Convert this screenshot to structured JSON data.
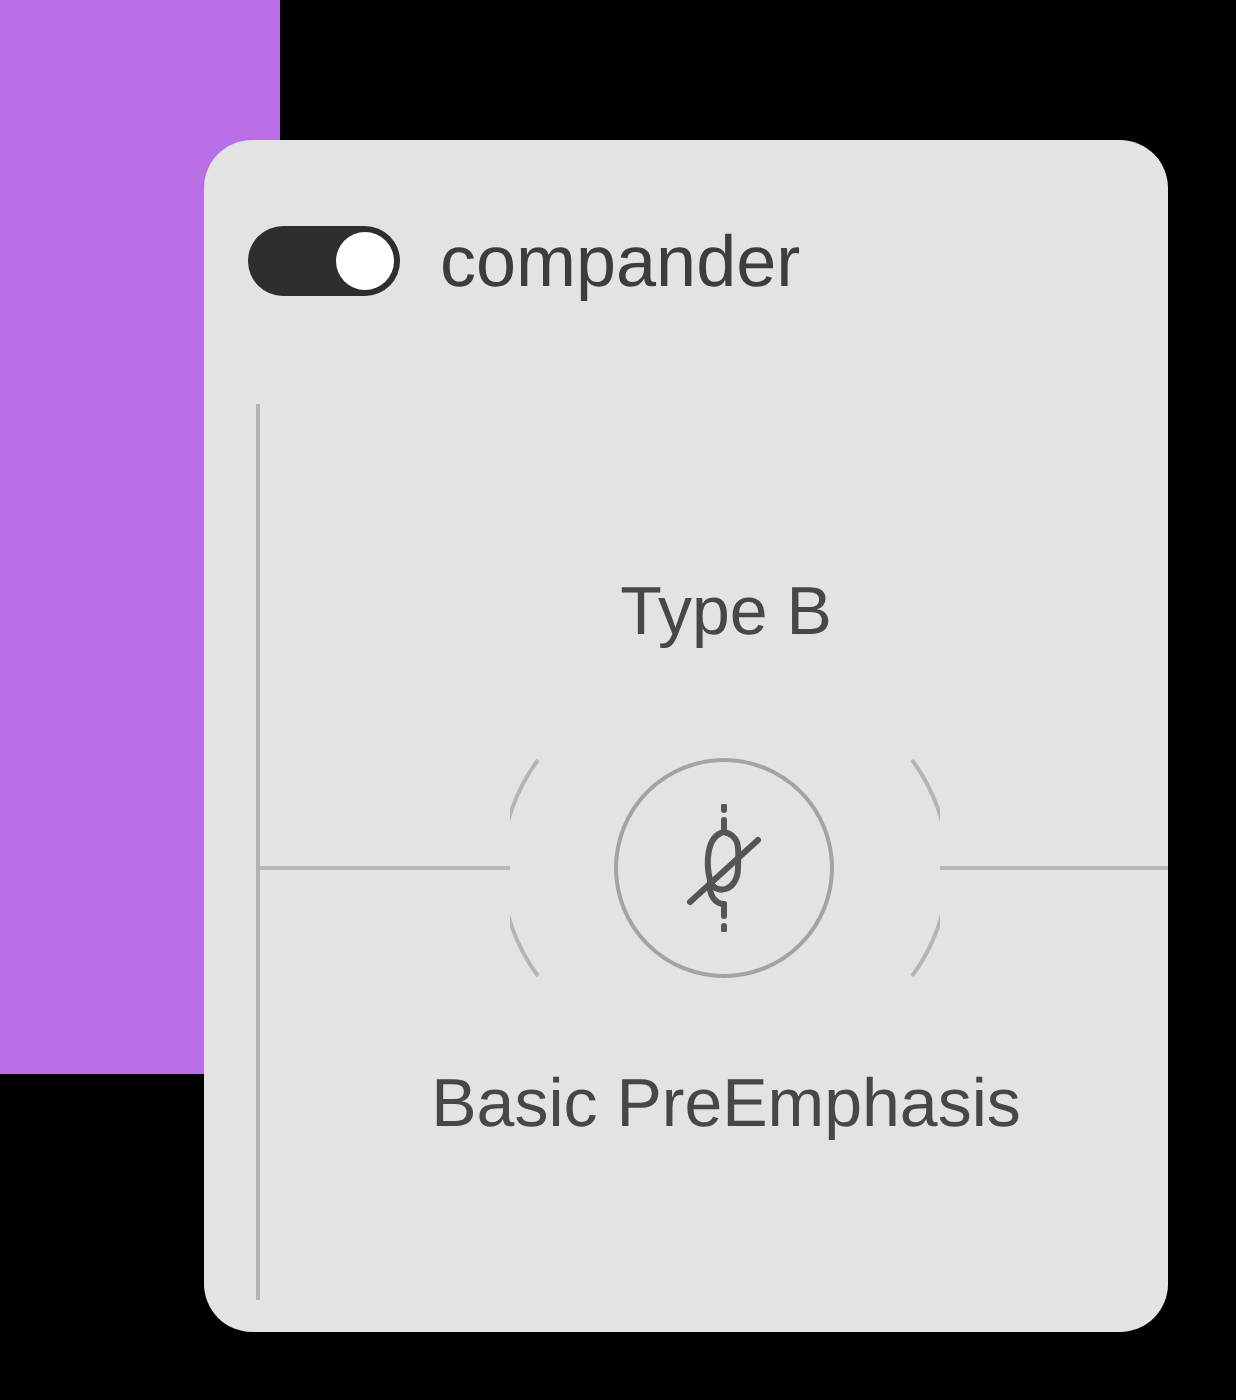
{
  "toggle": {
    "on": true,
    "label": "compander"
  },
  "type_label": "Type B",
  "preset_label": "Basic PreEmphasis"
}
